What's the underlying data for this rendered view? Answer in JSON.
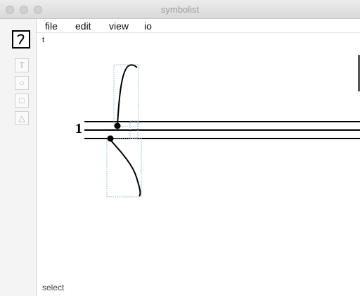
{
  "window": {
    "title": "symbolist"
  },
  "menu": [
    "file",
    "edit",
    "view",
    "io"
  ],
  "palette": {
    "selected_icon": "curve-icon",
    "items": [
      {
        "icon": "text-icon",
        "glyph": "T"
      },
      {
        "icon": "circle-icon",
        "glyph": "○"
      },
      {
        "icon": "square-icon",
        "glyph": "□"
      },
      {
        "icon": "triangle-icon",
        "glyph": "△"
      }
    ]
  },
  "canvas": {
    "tool_letter": "t",
    "staff_number": "1"
  },
  "status": {
    "text": "select"
  }
}
